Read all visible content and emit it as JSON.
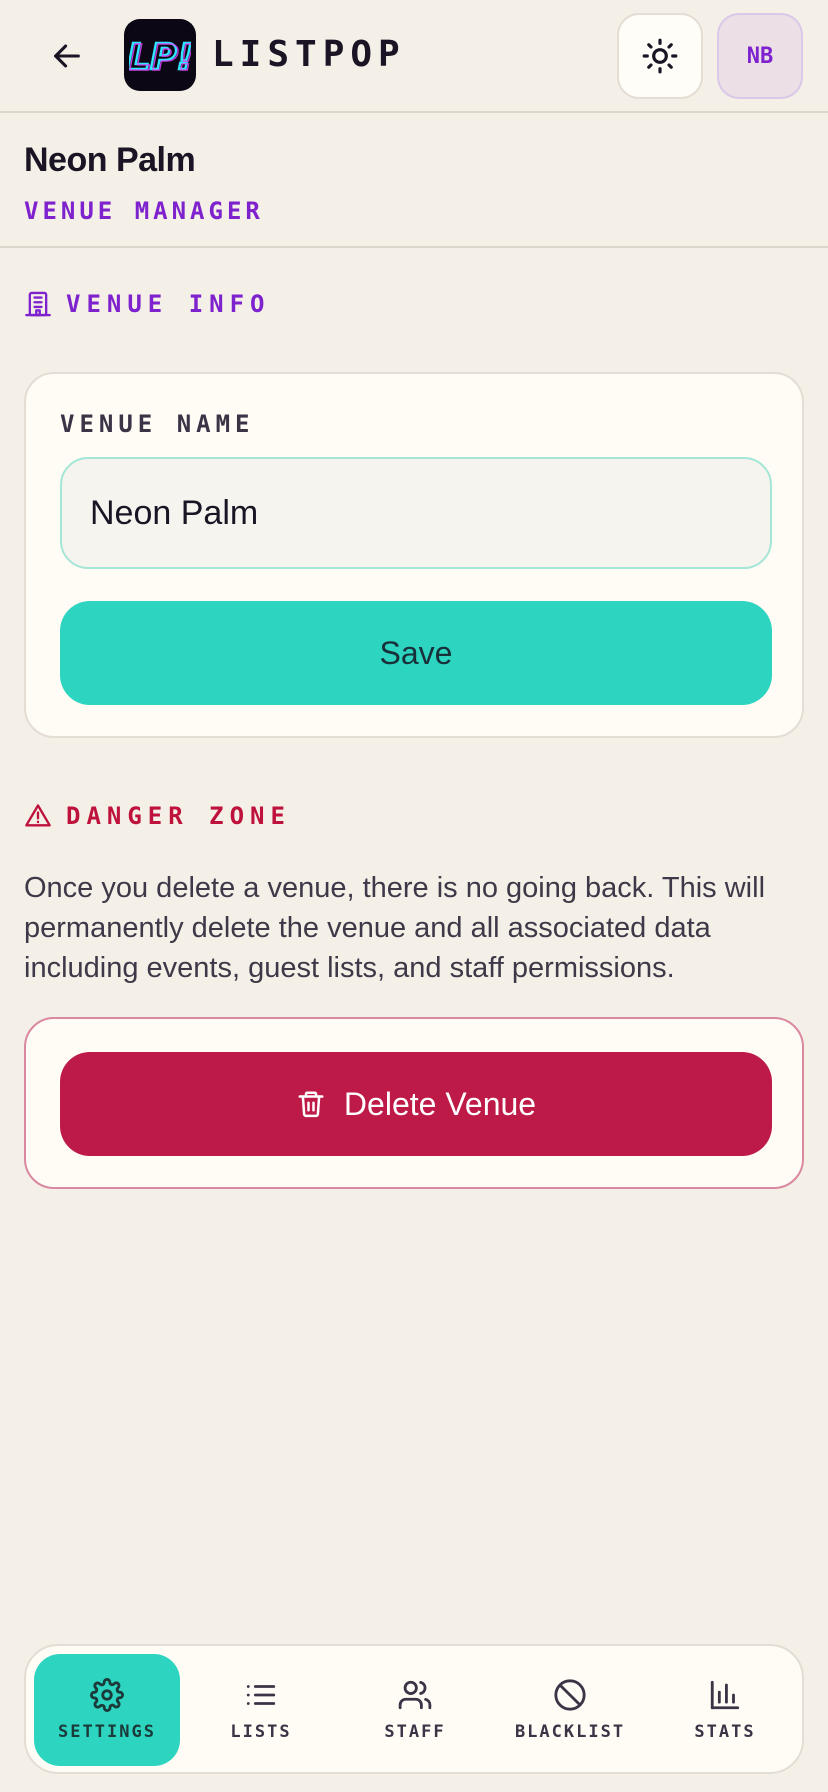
{
  "header": {
    "brand": "LISTPOP",
    "logo_text": "LP!",
    "avatar_initials": "NB"
  },
  "venue": {
    "title": "Neon Palm",
    "role": "VENUE MANAGER"
  },
  "venue_info": {
    "section_title": "VENUE INFO",
    "field_label": "VENUE NAME",
    "name_value": "Neon Palm",
    "save_label": "Save"
  },
  "danger_zone": {
    "section_title": "DANGER ZONE",
    "description": "Once you delete a venue, there is no going back. This will permanently delete the venue and all associated data including events, guest lists, and staff permissions.",
    "delete_label": "Delete Venue"
  },
  "nav": {
    "items": [
      {
        "label": "SETTINGS",
        "icon": "gear-icon",
        "active": true
      },
      {
        "label": "LISTS",
        "icon": "list-icon",
        "active": false
      },
      {
        "label": "STAFF",
        "icon": "users-icon",
        "active": false
      },
      {
        "label": "BLACKLIST",
        "icon": "ban-icon",
        "active": false
      },
      {
        "label": "STATS",
        "icon": "bar-chart-icon",
        "active": false
      }
    ]
  },
  "colors": {
    "accent": "#2dd4bf",
    "brand_purple": "#7e22ce",
    "danger": "#be1a48",
    "background": "#f4efe7"
  }
}
